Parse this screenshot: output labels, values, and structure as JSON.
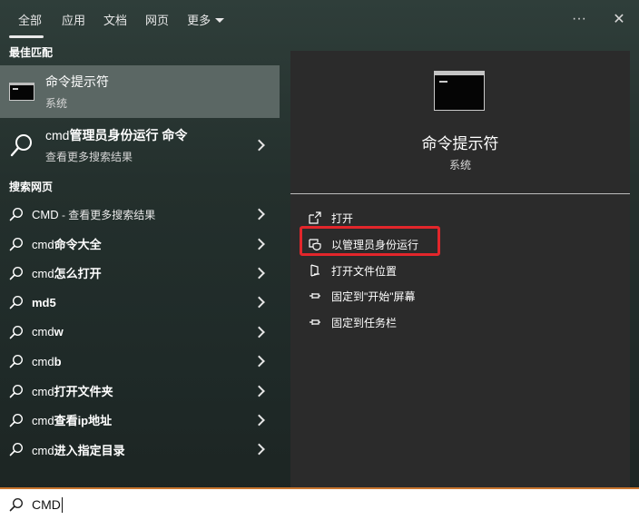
{
  "tabs": [
    {
      "label": "全部",
      "active": true
    },
    {
      "label": "应用"
    },
    {
      "label": "文档"
    },
    {
      "label": "网页"
    },
    {
      "label": "更多"
    }
  ],
  "top_actions": {
    "more": "···",
    "close": "✕"
  },
  "left": {
    "best_match_title": "最佳匹配",
    "best_match": {
      "title": "命令提示符",
      "subtitle": "系统"
    },
    "cmd_run": {
      "title_plain": "cmd",
      "title_bold": "管理员身份运行 命令",
      "subtitle": "查看更多搜索结果"
    },
    "web_title": "搜索网页",
    "web_items": [
      {
        "plain": "CMD",
        "thin": " - 查看更多搜索结果",
        "bold": ""
      },
      {
        "plain": "cmd",
        "bold": "命令大全",
        "thin": ""
      },
      {
        "plain": "cmd",
        "bold": "怎么打开",
        "thin": ""
      },
      {
        "plain": "",
        "bold": "md5",
        "thin": ""
      },
      {
        "plain": "cmd",
        "bold": "w",
        "thin": ""
      },
      {
        "plain": "cmd",
        "bold": "b",
        "thin": ""
      },
      {
        "plain": "cmd",
        "bold": "打开文件夹",
        "thin": ""
      },
      {
        "plain": "cmd",
        "bold": "查看ip地址",
        "thin": ""
      },
      {
        "plain": "cmd",
        "bold": "进入指定目录",
        "thin": ""
      }
    ]
  },
  "preview": {
    "title": "命令提示符",
    "subtitle": "系统",
    "actions": [
      {
        "label": "打开",
        "icon": "open-icon"
      },
      {
        "label": "以管理员身份运行",
        "icon": "shield-icon"
      },
      {
        "label": "打开文件位置",
        "icon": "file-location-icon"
      },
      {
        "label": "固定到\"开始\"屏幕",
        "icon": "pin-icon"
      },
      {
        "label": "固定到任务栏",
        "icon": "pin-icon"
      }
    ]
  },
  "search": {
    "value": "CMD"
  },
  "colors": {
    "highlight_box": "#e2262b",
    "accent_border": "#c9762f"
  }
}
